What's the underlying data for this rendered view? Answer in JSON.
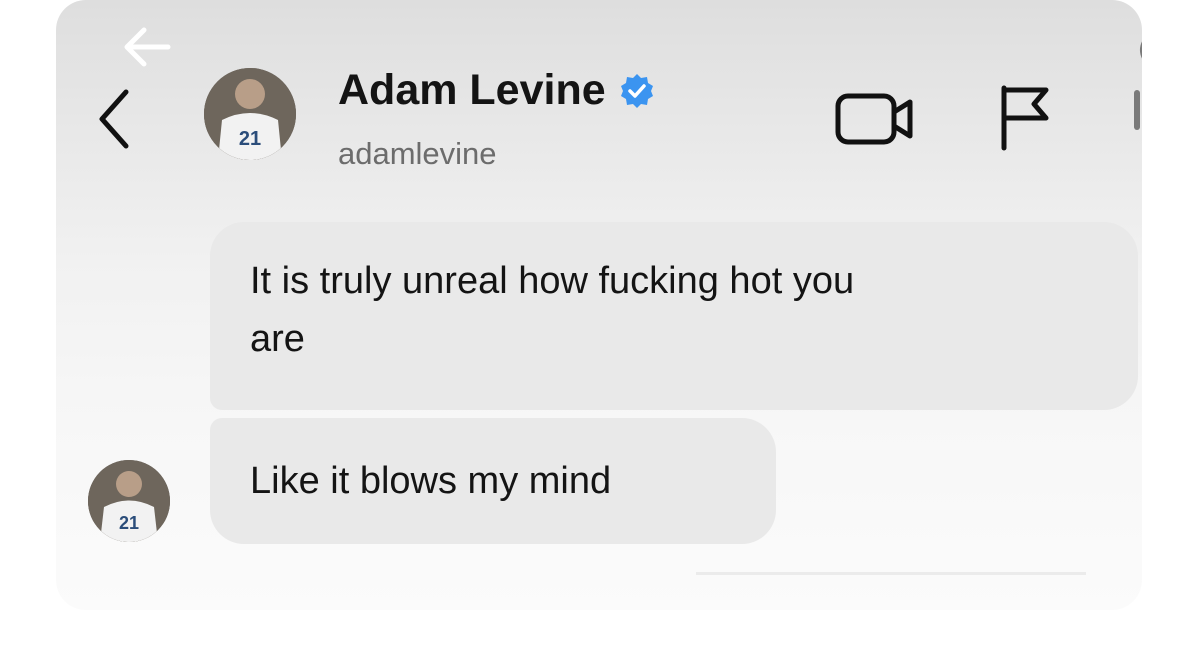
{
  "header": {
    "display_name": "Adam Levine",
    "username": "adamlevine",
    "verified": true,
    "icons": {
      "top_left": "arrow-left-icon",
      "back": "chevron-left-icon",
      "video_call": "video-camera-icon",
      "report": "flag-icon"
    }
  },
  "messages": [
    {
      "lines": [
        "It is truly unreal how fucking hot you",
        "are"
      ]
    },
    {
      "lines": [
        "Like it blows my mind"
      ]
    }
  ],
  "colors": {
    "bubble": "#e9e9e9",
    "verified_badge": "#3b94f0",
    "username_text": "#6c6c6c"
  }
}
